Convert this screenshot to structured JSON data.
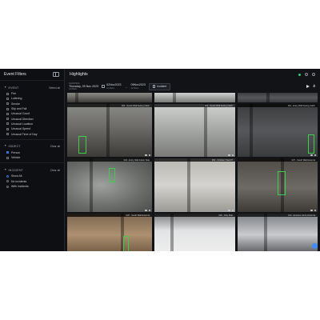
{
  "sidebar": {
    "title": "Event Filters",
    "event": {
      "label": "EVENT",
      "action": "Select all",
      "items": [
        {
          "label": "Fire",
          "checked": false
        },
        {
          "label": "Loitering",
          "checked": false
        },
        {
          "label": "Smoke",
          "checked": false
        },
        {
          "label": "Slip and Fall",
          "checked": false
        },
        {
          "label": "Unusual Count",
          "checked": false
        },
        {
          "label": "Unusual Direction",
          "checked": false
        },
        {
          "label": "Unusual Location",
          "checked": false
        },
        {
          "label": "Unusual Speed",
          "checked": false
        },
        {
          "label": "Unusual Time of Day",
          "checked": false
        }
      ]
    },
    "object": {
      "label": "OBJECT",
      "action": "Clear all",
      "items": [
        {
          "label": "Person",
          "checked": true
        },
        {
          "label": "Vehicle",
          "checked": false
        }
      ]
    },
    "incident": {
      "label": "INCIDENT",
      "action": "Clear all",
      "items": [
        {
          "label": "Show All",
          "checked": true
        },
        {
          "label": "No incidents",
          "checked": false
        },
        {
          "label": "With incidents",
          "checked": false
        }
      ]
    }
  },
  "header": {
    "title": "Highlights"
  },
  "filterbar": {
    "range_label": "SHOWING",
    "range_value": "Thursday, 09 Nov 2023",
    "range_sub": "12:00am",
    "start": {
      "date": "02Nov2023",
      "time": "12:00am"
    },
    "end": {
      "date": "09Nov2023",
      "time": "12:00am"
    },
    "incident_button": "Incident"
  },
  "tiles": [
    {
      "label": "",
      "scene": "s-street"
    },
    {
      "label": "",
      "scene": "s-lobby"
    },
    {
      "label": "",
      "scene": "s-hall"
    },
    {
      "label": "003 - South Wall Facing Cabin",
      "scene": "s-street",
      "boxes": [
        [
          14,
          40,
          10,
          22
        ]
      ]
    },
    {
      "label": "002 - South Wall Facing Cabin",
      "scene": "s-lobby",
      "boxes": []
    },
    {
      "label": "011 - Entry Wall Facing Cabin",
      "scene": "s-hall",
      "boxes": [
        [
          88,
          38,
          8,
          24
        ]
      ]
    },
    {
      "label": "024 - Entry Wall Indoor Side",
      "scene": "s-fog",
      "boxes": [
        [
          52,
          12,
          8,
          18
        ]
      ]
    },
    {
      "label": "002 - Chicken Triad 07",
      "scene": "s-room",
      "boxes": []
    },
    {
      "label": "027 - South Wall External",
      "scene": "s-dark",
      "boxes": [
        [
          50,
          16,
          10,
          30
        ]
      ]
    },
    {
      "label": "020 - South Wall External",
      "scene": "s-wood",
      "boxes": [
        [
          70,
          28,
          7,
          20
        ]
      ]
    },
    {
      "label": "026 - Kitty Side",
      "scene": "s-snow",
      "boxes": []
    },
    {
      "label": "010 - Entrance Entry External",
      "scene": "s-glass",
      "boxes": []
    }
  ]
}
